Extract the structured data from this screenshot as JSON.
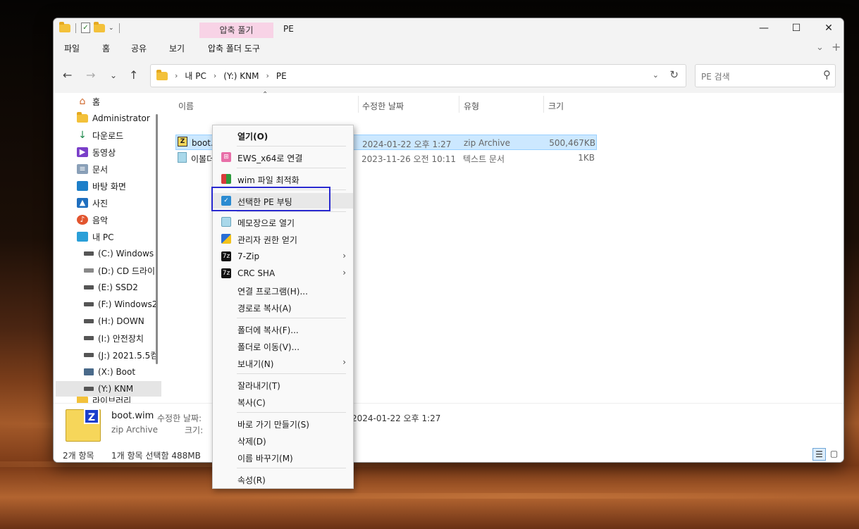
{
  "window": {
    "context_tab": "압축 풀기",
    "title": "PE",
    "minimize": "—",
    "maximize": "☐",
    "close": "✕"
  },
  "ribbon": {
    "tabs": [
      "파일",
      "홈",
      "공유",
      "보기",
      "압축 폴더 도구"
    ],
    "collapse_icon": "⌄",
    "add_icon": "+"
  },
  "address": {
    "segments": [
      "내 PC",
      "(Y:) KNM",
      "PE"
    ],
    "search_placeholder": "PE 검색"
  },
  "nav_pane": {
    "items": [
      "홈",
      "Administrator",
      "다운로드",
      "동영상",
      "문서",
      "바탕 화면",
      "사진",
      "음악",
      "내 PC"
    ],
    "drives": [
      "(C:) Windows",
      "(D:) CD 드라이",
      "(E:) SSD2",
      "(F:) Windows2",
      "(H:) DOWN",
      "(I:) 안전장치",
      "(J:) 2021.5.5컴",
      "(X:) Boot",
      "(Y:) KNM"
    ],
    "partial": "라이브러리"
  },
  "file_list": {
    "columns": [
      "이름",
      "수정한 날짜",
      "유형",
      "크기"
    ],
    "rows": [
      {
        "name": "boot.wim",
        "date": "2024-01-22 오후 1:27",
        "type": "zip Archive",
        "size": "500,467KB"
      },
      {
        "name": "이볼더",
        "date": "2023-11-26 오전 10:11",
        "type": "텍스트 문서",
        "size": "1KB"
      }
    ]
  },
  "details": {
    "name": "boot.wim",
    "type": "zip Archive",
    "modified_label": "수정한 날짜:",
    "modified_value": "2024-01-22 오후 1:27",
    "size_label": "크기:"
  },
  "status": {
    "item_count": "2개 항목",
    "selection": "1개 항목 선택함 488MB"
  },
  "context_menu": {
    "open": "열기(O)",
    "ews": "EWS_x64로 연결",
    "wim_opt": "wim 파일 최적화",
    "pe_boot": "선택한  PE 부팅",
    "notepad": "메모장으로  열기",
    "admin": "관리자 권한 얻기",
    "zip7": "7-Zip",
    "crc": "CRC SHA",
    "open_with": "연결 프로그램(H)...",
    "copy_path": "경로로 복사(A)",
    "copy_to": "폴더에 복사(F)...",
    "move_to": "폴더로 이동(V)...",
    "send_to": "보내기(N)",
    "cut": "잘라내기(T)",
    "copy": "복사(C)",
    "shortcut": "바로 가기 만들기(S)",
    "delete": "삭제(D)",
    "rename": "이름 바꾸기(M)",
    "properties": "속성(R)"
  }
}
